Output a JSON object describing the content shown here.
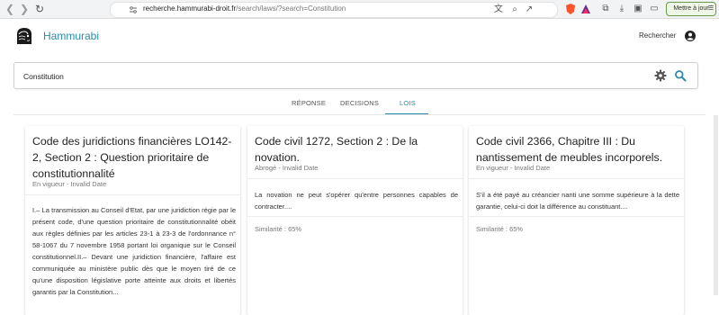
{
  "browser": {
    "url_host": "recherche.hammurabi-droit.fr",
    "url_path": "/search/laws/?search=Constitution",
    "update_label": "Mettre à jour"
  },
  "app": {
    "brand": "Hammurabi",
    "header_search_label": "Rechercher",
    "accent": "#2c8aa8"
  },
  "search": {
    "value": "Constitution"
  },
  "tabs": [
    {
      "label": "RÉPONSE"
    },
    {
      "label": "DECISIONS"
    },
    {
      "label": "LOIS"
    }
  ],
  "cards": [
    {
      "title": "Code des juridictions financières LO142-2, Section 2 : Question prioritaire de constitutionnalité",
      "status": "En vigueur",
      "date": "Invalid Date",
      "body": "I.– La transmission au Conseil d'Etat, par une juridiction régie par le présent code, d'une question prioritaire de constitutionnalité obéit aux règles définies par les articles 23-1 à 23-3 de l'ordonnance n° 58-1067 du 7 novembre 1958 portant loi organique sur le Conseil constitutionnel.II.– Devant une juridiction financière, l'affaire est communiquée au ministère public dès que le moyen tiré de ce qu'une disposition législative porte atteinte aux droits et libertés garantis par la Constitution...",
      "similarity": ""
    },
    {
      "title": "Code civil 1272, Section 2 : De la novation.",
      "status": "Abrogé",
      "date": "Invalid Date",
      "body": "La novation ne peut s'opérer qu'entre personnes capables de contracter....",
      "similarity": "Similarité : 65%"
    },
    {
      "title": "Code civil 2366, Chapitre III : Du nantissement de meubles incorporels.",
      "status": "En vigueur",
      "date": "Invalid Date",
      "body": "S'il a été payé au créancier nanti une somme supérieure à la dette garantie, celui-ci doit la différence au constituant....",
      "similarity": "Similarité : 65%"
    }
  ]
}
